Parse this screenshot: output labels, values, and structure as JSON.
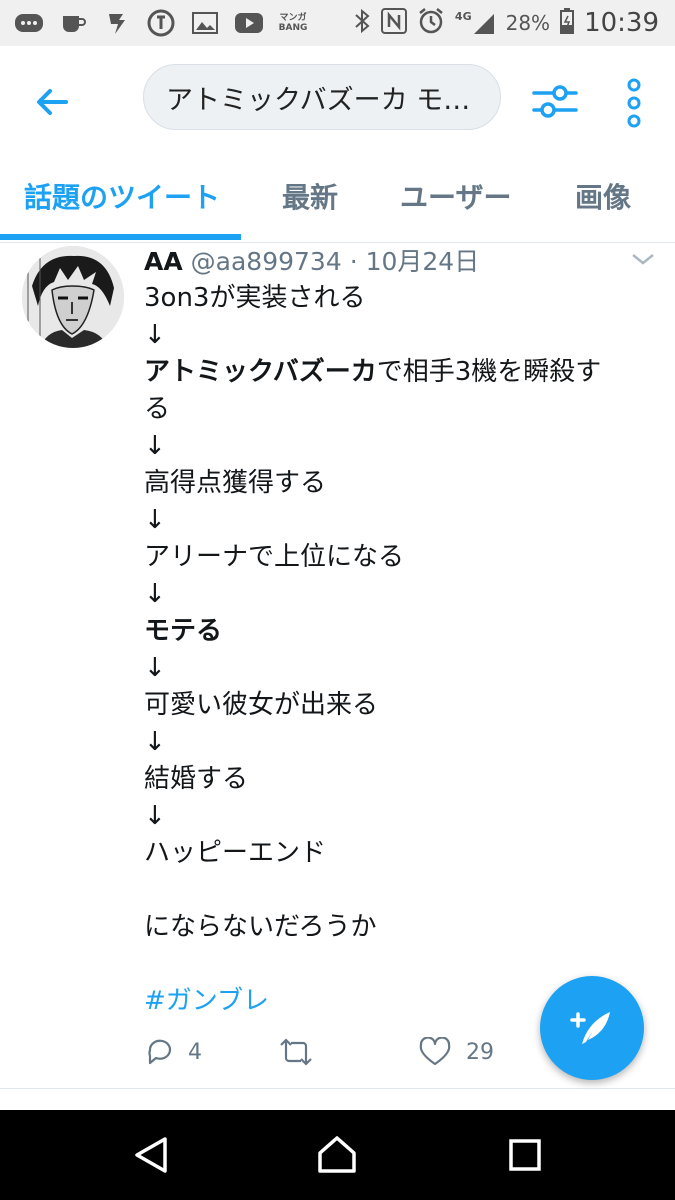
{
  "status_bar": {
    "manga_label_top": "マンガ",
    "manga_label_bottom": "BANG",
    "network": "4G",
    "battery": "28%",
    "time": "10:39"
  },
  "app_bar": {
    "search_text": "アトミックバズーカ モ…"
  },
  "tabs": [
    {
      "label": "話題のツイート",
      "active": true
    },
    {
      "label": "最新",
      "active": false
    },
    {
      "label": "ユーザー",
      "active": false
    },
    {
      "label": "画像",
      "active": false
    }
  ],
  "tweet": {
    "name": "AA",
    "handle": "@aa899734",
    "separator": "·",
    "date": "10月24日",
    "lines": [
      "3on3が実装される",
      "↓",
      "アトミックバズーカ",
      "で相手3機を瞬殺す",
      "る",
      "↓",
      "高得点獲得する",
      "↓",
      "アリーナで上位になる",
      "↓",
      "モテる",
      "↓",
      "可愛い彼女が出来る",
      "↓",
      "結婚する",
      "↓",
      "ハッピーエンド",
      "",
      "にならないだろうか"
    ],
    "hashtag": "#ガンブレ",
    "reply_count": "4",
    "retweet_count": "",
    "like_count": "29"
  },
  "colors": {
    "accent": "#1da1f2",
    "secondary_text": "#657786",
    "primary_text": "#14171a"
  }
}
